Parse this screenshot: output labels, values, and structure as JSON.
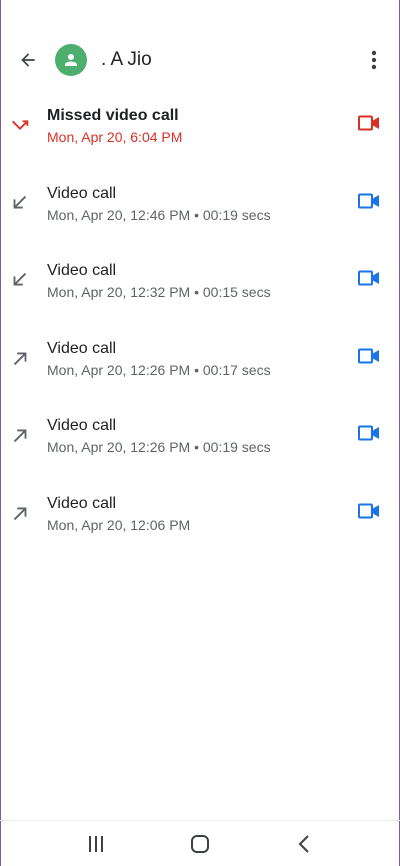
{
  "header": {
    "back_icon": "arrow-back-icon",
    "avatar_icon": "person-icon",
    "avatar_color": "#4caf6d",
    "contact_name": ". A Jio",
    "more_icon": "more-vertical-icon"
  },
  "colors": {
    "missed": "#d93025",
    "video_icon": "#1a73e8",
    "direction_icon": "#5f6368"
  },
  "calls": [
    {
      "type": "missed",
      "title": "Missed video call",
      "detail": "Mon, Apr 20, 6:04 PM",
      "direction_icon": "missed-call-icon",
      "action_icon": "videocam-icon"
    },
    {
      "type": "incoming",
      "title": "Video call",
      "detail": "Mon, Apr 20, 12:46 PM • 00:19 secs",
      "direction_icon": "incoming-call-icon",
      "action_icon": "videocam-icon"
    },
    {
      "type": "incoming",
      "title": "Video call",
      "detail": "Mon, Apr 20, 12:32 PM • 00:15 secs",
      "direction_icon": "incoming-call-icon",
      "action_icon": "videocam-icon"
    },
    {
      "type": "outgoing",
      "title": "Video call",
      "detail": "Mon, Apr 20, 12:26 PM • 00:17 secs",
      "direction_icon": "outgoing-call-icon",
      "action_icon": "videocam-icon"
    },
    {
      "type": "outgoing",
      "title": "Video call",
      "detail": "Mon, Apr 20, 12:26 PM • 00:19 secs",
      "direction_icon": "outgoing-call-icon",
      "action_icon": "videocam-icon"
    },
    {
      "type": "outgoing",
      "title": "Video call",
      "detail": "Mon, Apr 20, 12:06 PM",
      "direction_icon": "outgoing-call-icon",
      "action_icon": "videocam-icon"
    }
  ],
  "navbar": {
    "recents_icon": "recent-apps-icon",
    "home_icon": "home-icon",
    "back_icon": "nav-back-icon"
  }
}
